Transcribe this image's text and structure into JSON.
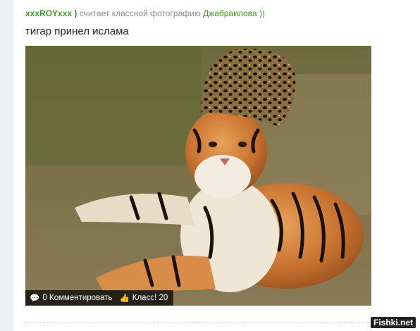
{
  "post": {
    "author": "xxxROYxxx )",
    "action_text": "считает классной фотографию",
    "target": "Джабраилова ))",
    "title": "тигар принел ислама"
  },
  "photo_bar": {
    "comments_label": "0 Комментировать",
    "likes_label": "Класс! 20",
    "comment_icon": "speech-bubble-icon",
    "like_icon": "thumbs-up-icon"
  },
  "watermark": "Fishki.net",
  "colors": {
    "author": "#3f9b1f",
    "meta_text": "#8a8a8a",
    "bar_bg": "#000000"
  }
}
